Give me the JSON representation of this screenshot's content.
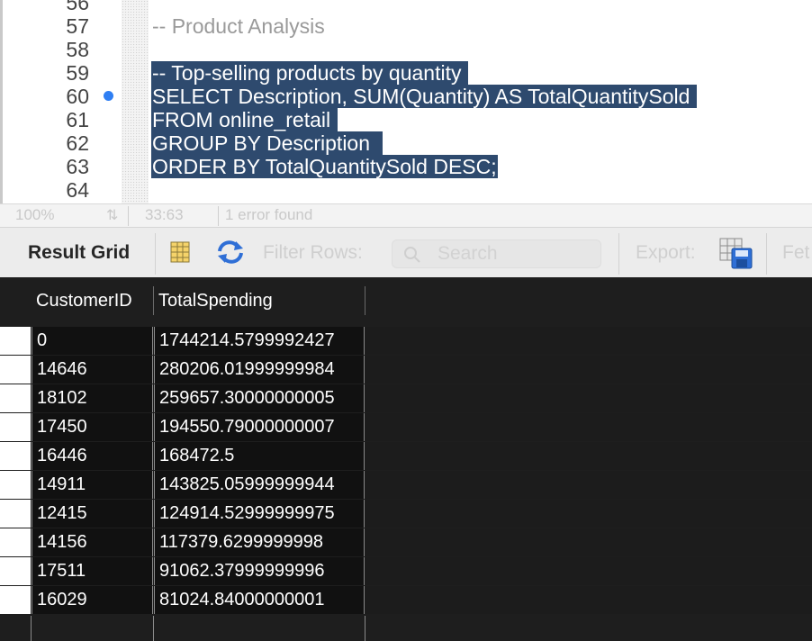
{
  "editor": {
    "line_numbers": [
      "56",
      "57",
      "58",
      "59",
      "60",
      "61",
      "62",
      "63",
      "64"
    ],
    "breakpoint_line": "60",
    "lines": {
      "57": "-- Product Analysis",
      "59": "-- Top-selling products by quantity ",
      "60": "SELECT Description, SUM(Quantity) AS TotalQuantitySold ",
      "61": "FROM online_retail ",
      "62": "GROUP BY Description  ",
      "63": "ORDER BY TotalQuantitySold DESC;"
    }
  },
  "statusbar": {
    "zoom": "100%",
    "cursor_position": "33:63",
    "error_text": "1 error found"
  },
  "toolbar": {
    "result_grid_label": "Result Grid",
    "filter_rows_label": "Filter Rows:",
    "search_placeholder": "Search",
    "export_label": "Export:",
    "fetch_label": "Fet"
  },
  "grid": {
    "columns": [
      "CustomerID",
      "TotalSpending"
    ],
    "rows": [
      [
        "0",
        "1744214.5799992427"
      ],
      [
        "14646",
        "280206.01999999984"
      ],
      [
        "18102",
        "259657.30000000005"
      ],
      [
        "17450",
        "194550.79000000007"
      ],
      [
        "16446",
        "168472.5"
      ],
      [
        "14911",
        "143825.05999999944"
      ],
      [
        "12415",
        "124914.52999999975"
      ],
      [
        "14156",
        "117379.6299999998"
      ],
      [
        "17511",
        "91062.37999999996"
      ],
      [
        "16029",
        "81024.84000000001"
      ]
    ]
  },
  "colors": {
    "selection": "#2e4a6e",
    "breakpoint": "#2f7ff3",
    "grid_background": "#1e1e1e"
  },
  "icons": [
    "grid-layout-icon",
    "wrap-cell-icon",
    "search-icon",
    "export-file-icon",
    "stepper-icon"
  ]
}
